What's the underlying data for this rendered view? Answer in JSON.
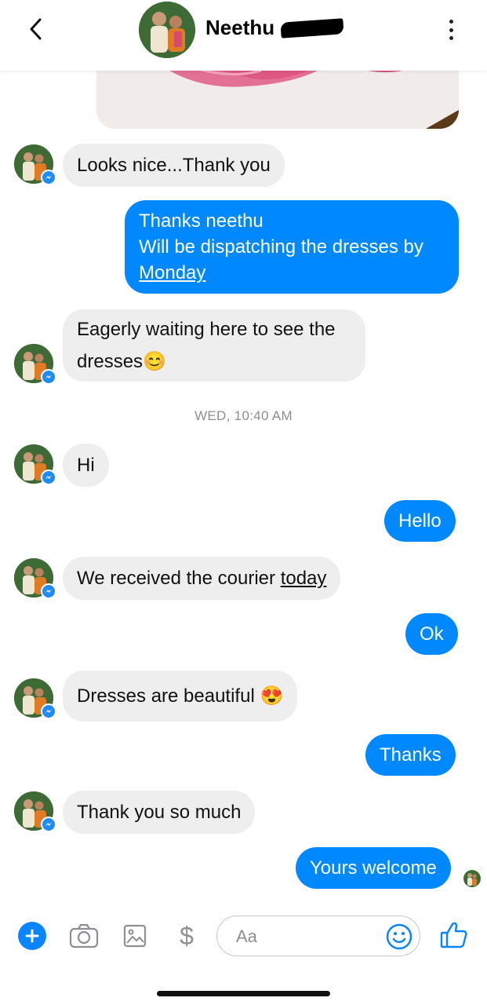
{
  "header": {
    "back_label": "‹",
    "contact_name": "Neethu",
    "more_label": "⋮"
  },
  "messages": [
    {
      "dir": "in",
      "text": "Looks nice...Thank you"
    },
    {
      "dir": "out",
      "line1": "Thanks neethu",
      "line2": "Will be dispatching the dresses by",
      "line3_link": "Monday"
    },
    {
      "dir": "in",
      "line1": "Eagerly waiting here to see the",
      "line2": "dresses",
      "emoji": "😊"
    },
    {
      "dir": "in",
      "text": "Hi"
    },
    {
      "dir": "out",
      "text": "Hello"
    },
    {
      "dir": "in",
      "text": "We received the courier ",
      "link": "today"
    },
    {
      "dir": "out",
      "text": "Ok"
    },
    {
      "dir": "in",
      "text": "Dresses are beautiful ",
      "emoji": "😍"
    },
    {
      "dir": "out",
      "text": "Thanks"
    },
    {
      "dir": "in",
      "text": "Thank you so much"
    },
    {
      "dir": "out",
      "text": "Yours welcome"
    }
  ],
  "timestamp": "WED, 10:40 AM",
  "composer": {
    "placeholder": "Aa",
    "dollar_label": "$"
  },
  "colors": {
    "outgoing_bubble": "#0088ff",
    "incoming_bubble": "#eeeeef",
    "accent": "#0a84ff"
  }
}
